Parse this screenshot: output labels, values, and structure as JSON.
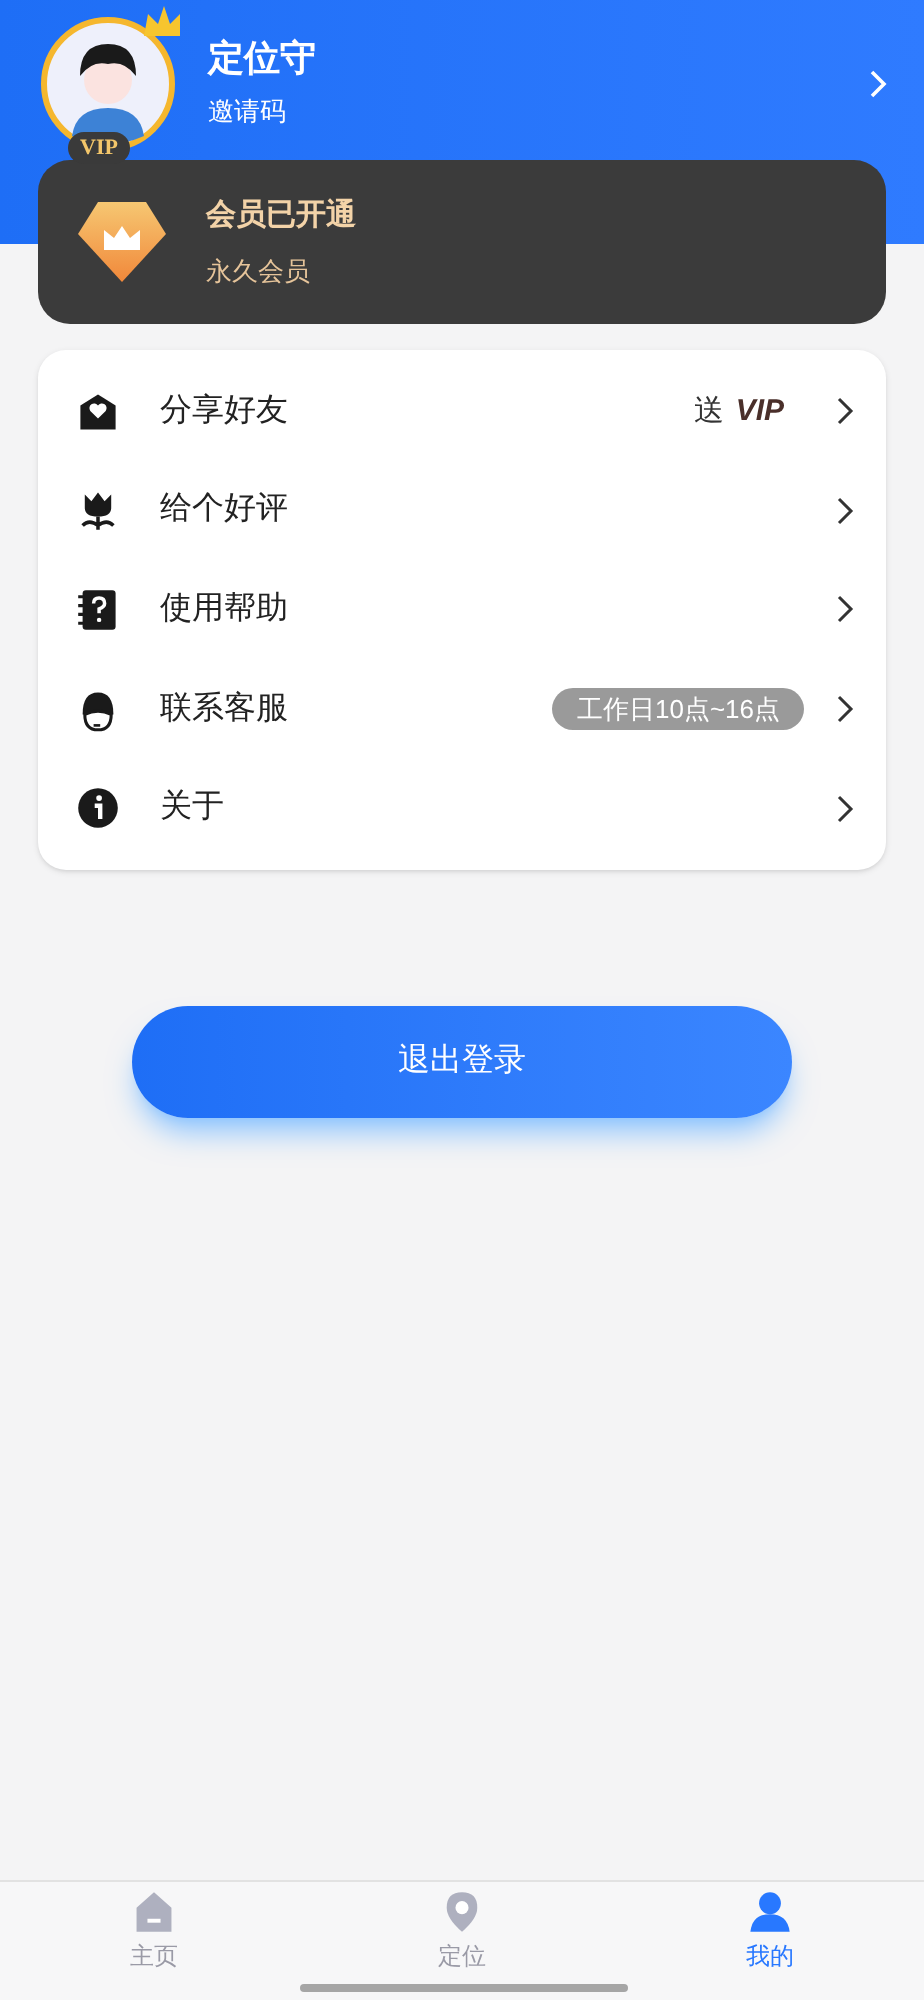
{
  "profile": {
    "name": "定位守",
    "invite_label": "邀请码",
    "vip": "VIP"
  },
  "membership": {
    "title": "会员已开通",
    "subtitle": "永久会员"
  },
  "menu": [
    {
      "kind": "share",
      "label": "分享好友",
      "extra": "送",
      "badge_vip": "VIP"
    },
    {
      "kind": "review",
      "label": "给个好评"
    },
    {
      "kind": "help",
      "label": "使用帮助"
    },
    {
      "kind": "service",
      "label": "联系客服",
      "tag": "工作日10点~16点"
    },
    {
      "kind": "about",
      "label": "关于"
    }
  ],
  "logout": "退出登录",
  "tabs": [
    {
      "kind": "home",
      "label": "主页",
      "selected": false
    },
    {
      "kind": "location",
      "label": "定位",
      "selected": false
    },
    {
      "kind": "me",
      "label": "我的",
      "selected": true
    }
  ]
}
